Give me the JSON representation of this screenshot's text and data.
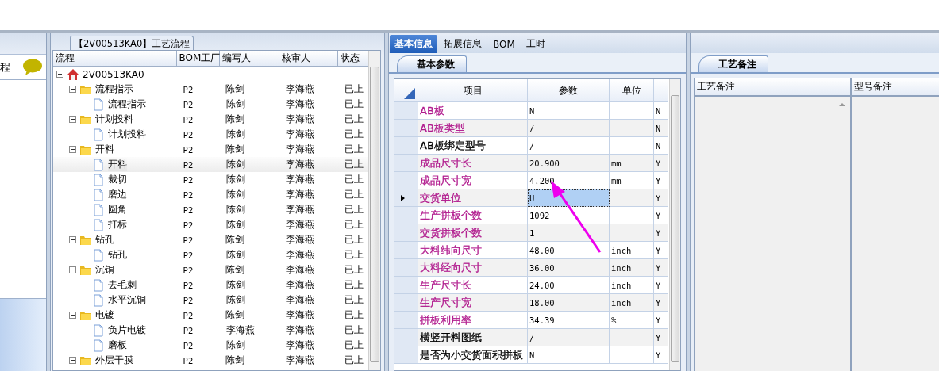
{
  "sidebar": {
    "label": "程"
  },
  "tree_panel": {
    "title": "【2V00513KA0】工艺流程",
    "columns": [
      "流程",
      "BOM工厂",
      "编写人",
      "核审人",
      "状态"
    ],
    "rows": [
      {
        "label": "2V00513KA0",
        "kind": "root",
        "expanded": true,
        "selected": false,
        "children": [
          {
            "label": "流程指示",
            "kind": "folder",
            "expanded": true,
            "selected": false,
            "bom": "P2",
            "author": "陈剑",
            "reviewer": "李海燕",
            "status": "已上",
            "children": [
              {
                "label": "流程指示",
                "kind": "step",
                "selected": false,
                "bom": "P2",
                "author": "陈剑",
                "reviewer": "李海燕",
                "status": "已上"
              }
            ]
          },
          {
            "label": "计划投料",
            "kind": "folder",
            "expanded": true,
            "selected": false,
            "bom": "P2",
            "author": "陈剑",
            "reviewer": "李海燕",
            "status": "已上",
            "children": [
              {
                "label": "计划投料",
                "kind": "step",
                "selected": false,
                "bom": "P2",
                "author": "陈剑",
                "reviewer": "李海燕",
                "status": "已上"
              }
            ]
          },
          {
            "label": "开料",
            "kind": "folder",
            "expanded": true,
            "selected": false,
            "bom": "P2",
            "author": "陈剑",
            "reviewer": "李海燕",
            "status": "已上",
            "children": [
              {
                "label": "开料",
                "kind": "step",
                "selected": true,
                "bom": "P2",
                "author": "陈剑",
                "reviewer": "李海燕",
                "status": "已上"
              },
              {
                "label": "裁切",
                "kind": "step",
                "selected": false,
                "bom": "P2",
                "author": "陈剑",
                "reviewer": "李海燕",
                "status": "已上"
              },
              {
                "label": "磨边",
                "kind": "step",
                "selected": false,
                "bom": "P2",
                "author": "陈剑",
                "reviewer": "李海燕",
                "status": "已上"
              },
              {
                "label": "圆角",
                "kind": "step",
                "selected": false,
                "bom": "P2",
                "author": "陈剑",
                "reviewer": "李海燕",
                "status": "已上"
              },
              {
                "label": "打标",
                "kind": "step",
                "selected": false,
                "bom": "P2",
                "author": "陈剑",
                "reviewer": "李海燕",
                "status": "已上"
              }
            ]
          },
          {
            "label": "钻孔",
            "kind": "folder",
            "expanded": true,
            "selected": false,
            "bom": "P2",
            "author": "陈剑",
            "reviewer": "李海燕",
            "status": "已上",
            "children": [
              {
                "label": "钻孔",
                "kind": "step",
                "selected": false,
                "bom": "P2",
                "author": "陈剑",
                "reviewer": "李海燕",
                "status": "已上"
              }
            ]
          },
          {
            "label": "沉铜",
            "kind": "folder",
            "expanded": true,
            "selected": false,
            "bom": "P2",
            "author": "陈剑",
            "reviewer": "李海燕",
            "status": "已上",
            "children": [
              {
                "label": "去毛刺",
                "kind": "step",
                "selected": false,
                "bom": "P2",
                "author": "陈剑",
                "reviewer": "李海燕",
                "status": "已上"
              },
              {
                "label": "水平沉铜",
                "kind": "step",
                "selected": false,
                "bom": "P2",
                "author": "陈剑",
                "reviewer": "李海燕",
                "status": "已上"
              }
            ]
          },
          {
            "label": "电镀",
            "kind": "folder",
            "expanded": true,
            "selected": false,
            "bom": "P2",
            "author": "陈剑",
            "reviewer": "李海燕",
            "status": "已上",
            "children": [
              {
                "label": "负片电镀",
                "kind": "step",
                "selected": false,
                "bom": "P2",
                "author": "李海燕",
                "reviewer": "李海燕",
                "status": "已上"
              },
              {
                "label": "磨板",
                "kind": "step",
                "selected": false,
                "bom": "P2",
                "author": "陈剑",
                "reviewer": "李海燕",
                "status": "已上"
              }
            ]
          },
          {
            "label": "外层干膜",
            "kind": "folder",
            "expanded": true,
            "selected": false,
            "bom": "P2",
            "author": "陈剑",
            "reviewer": "李海燕",
            "status": "已上"
          }
        ]
      }
    ]
  },
  "detail_panel": {
    "tabs": [
      {
        "label": "基本信息",
        "selected": true
      },
      {
        "label": "拓展信息",
        "selected": false
      },
      {
        "label": "BOM",
        "selected": false
      },
      {
        "label": "工时",
        "selected": false
      }
    ],
    "subtab": "基本参数",
    "columns": [
      "项目",
      "参数",
      "单位"
    ],
    "rows": [
      {
        "item": "AB板",
        "value": "N",
        "unit": "",
        "flag": "N",
        "color": "#b0188c",
        "selected": false
      },
      {
        "item": "AB板类型",
        "value": "/",
        "unit": "",
        "flag": "N",
        "color": "#b0188c",
        "selected": false
      },
      {
        "item": "AB板绑定型号",
        "value": "/",
        "unit": "",
        "flag": "N",
        "color": "#000000",
        "selected": false
      },
      {
        "item": "成品尺寸长",
        "value": "20.900",
        "unit": "mm",
        "flag": "Y",
        "color": "#b0188c",
        "selected": false
      },
      {
        "item": "成品尺寸宽",
        "value": "4.200",
        "unit": "mm",
        "flag": "Y",
        "color": "#b0188c",
        "selected": false
      },
      {
        "item": "交货单位",
        "value": "U",
        "unit": "",
        "flag": "Y",
        "color": "#b0188c",
        "selected": true
      },
      {
        "item": "生产拼板个数",
        "value": "1092",
        "unit": "",
        "flag": "Y",
        "color": "#b0188c",
        "selected": false
      },
      {
        "item": "交货拼板个数",
        "value": "1",
        "unit": "",
        "flag": "Y",
        "color": "#b0188c",
        "selected": false
      },
      {
        "item": "大料纬向尺寸",
        "value": "48.00",
        "unit": "inch",
        "flag": "Y",
        "color": "#b0188c",
        "selected": false
      },
      {
        "item": "大料经向尺寸",
        "value": "36.00",
        "unit": "inch",
        "flag": "Y",
        "color": "#b0188c",
        "selected": false
      },
      {
        "item": "生产尺寸长",
        "value": "24.00",
        "unit": "inch",
        "flag": "Y",
        "color": "#b0188c",
        "selected": false
      },
      {
        "item": "生产尺寸宽",
        "value": "18.00",
        "unit": "inch",
        "flag": "Y",
        "color": "#b0188c",
        "selected": false
      },
      {
        "item": "拼板利用率",
        "value": "34.39",
        "unit": "%",
        "flag": "Y",
        "color": "#b0188c",
        "selected": false
      },
      {
        "item": "横竖开料图纸",
        "value": "/",
        "unit": "",
        "flag": "Y",
        "color": "#000000",
        "selected": false
      },
      {
        "item": "是否为小交货面积拼板",
        "value": "N",
        "unit": "",
        "flag": "Y",
        "color": "#000000",
        "selected": false
      }
    ]
  },
  "notes_panel": {
    "subtab": "工艺备注",
    "columns": [
      "工艺备注",
      "型号备注"
    ]
  }
}
